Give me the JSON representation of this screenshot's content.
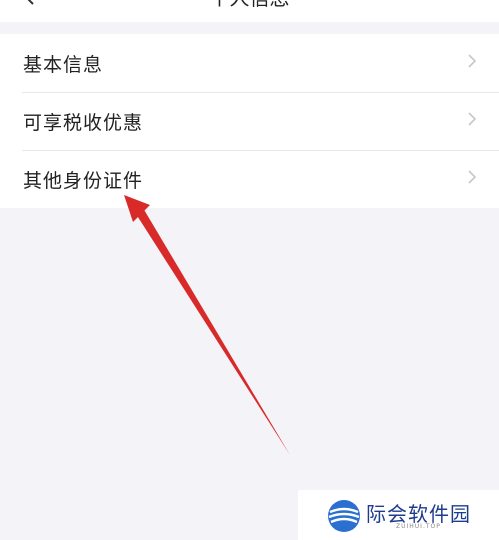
{
  "header": {
    "title": "个人信息"
  },
  "menu": {
    "items": [
      {
        "label": "基本信息"
      },
      {
        "label": "可享税收优惠"
      },
      {
        "label": "其他身份证件"
      }
    ]
  },
  "watermark": {
    "name": "际会软件园",
    "subtitle": "ZUIHUI.TOP"
  },
  "colors": {
    "background": "#f3f3f8",
    "arrow": "#d92a2a",
    "watermark_text": "#1d3c8f"
  },
  "icons": [
    "back-arrow-icon",
    "chevron-right-icon",
    "red-annotation-arrow",
    "watermark-logo-icon"
  ]
}
